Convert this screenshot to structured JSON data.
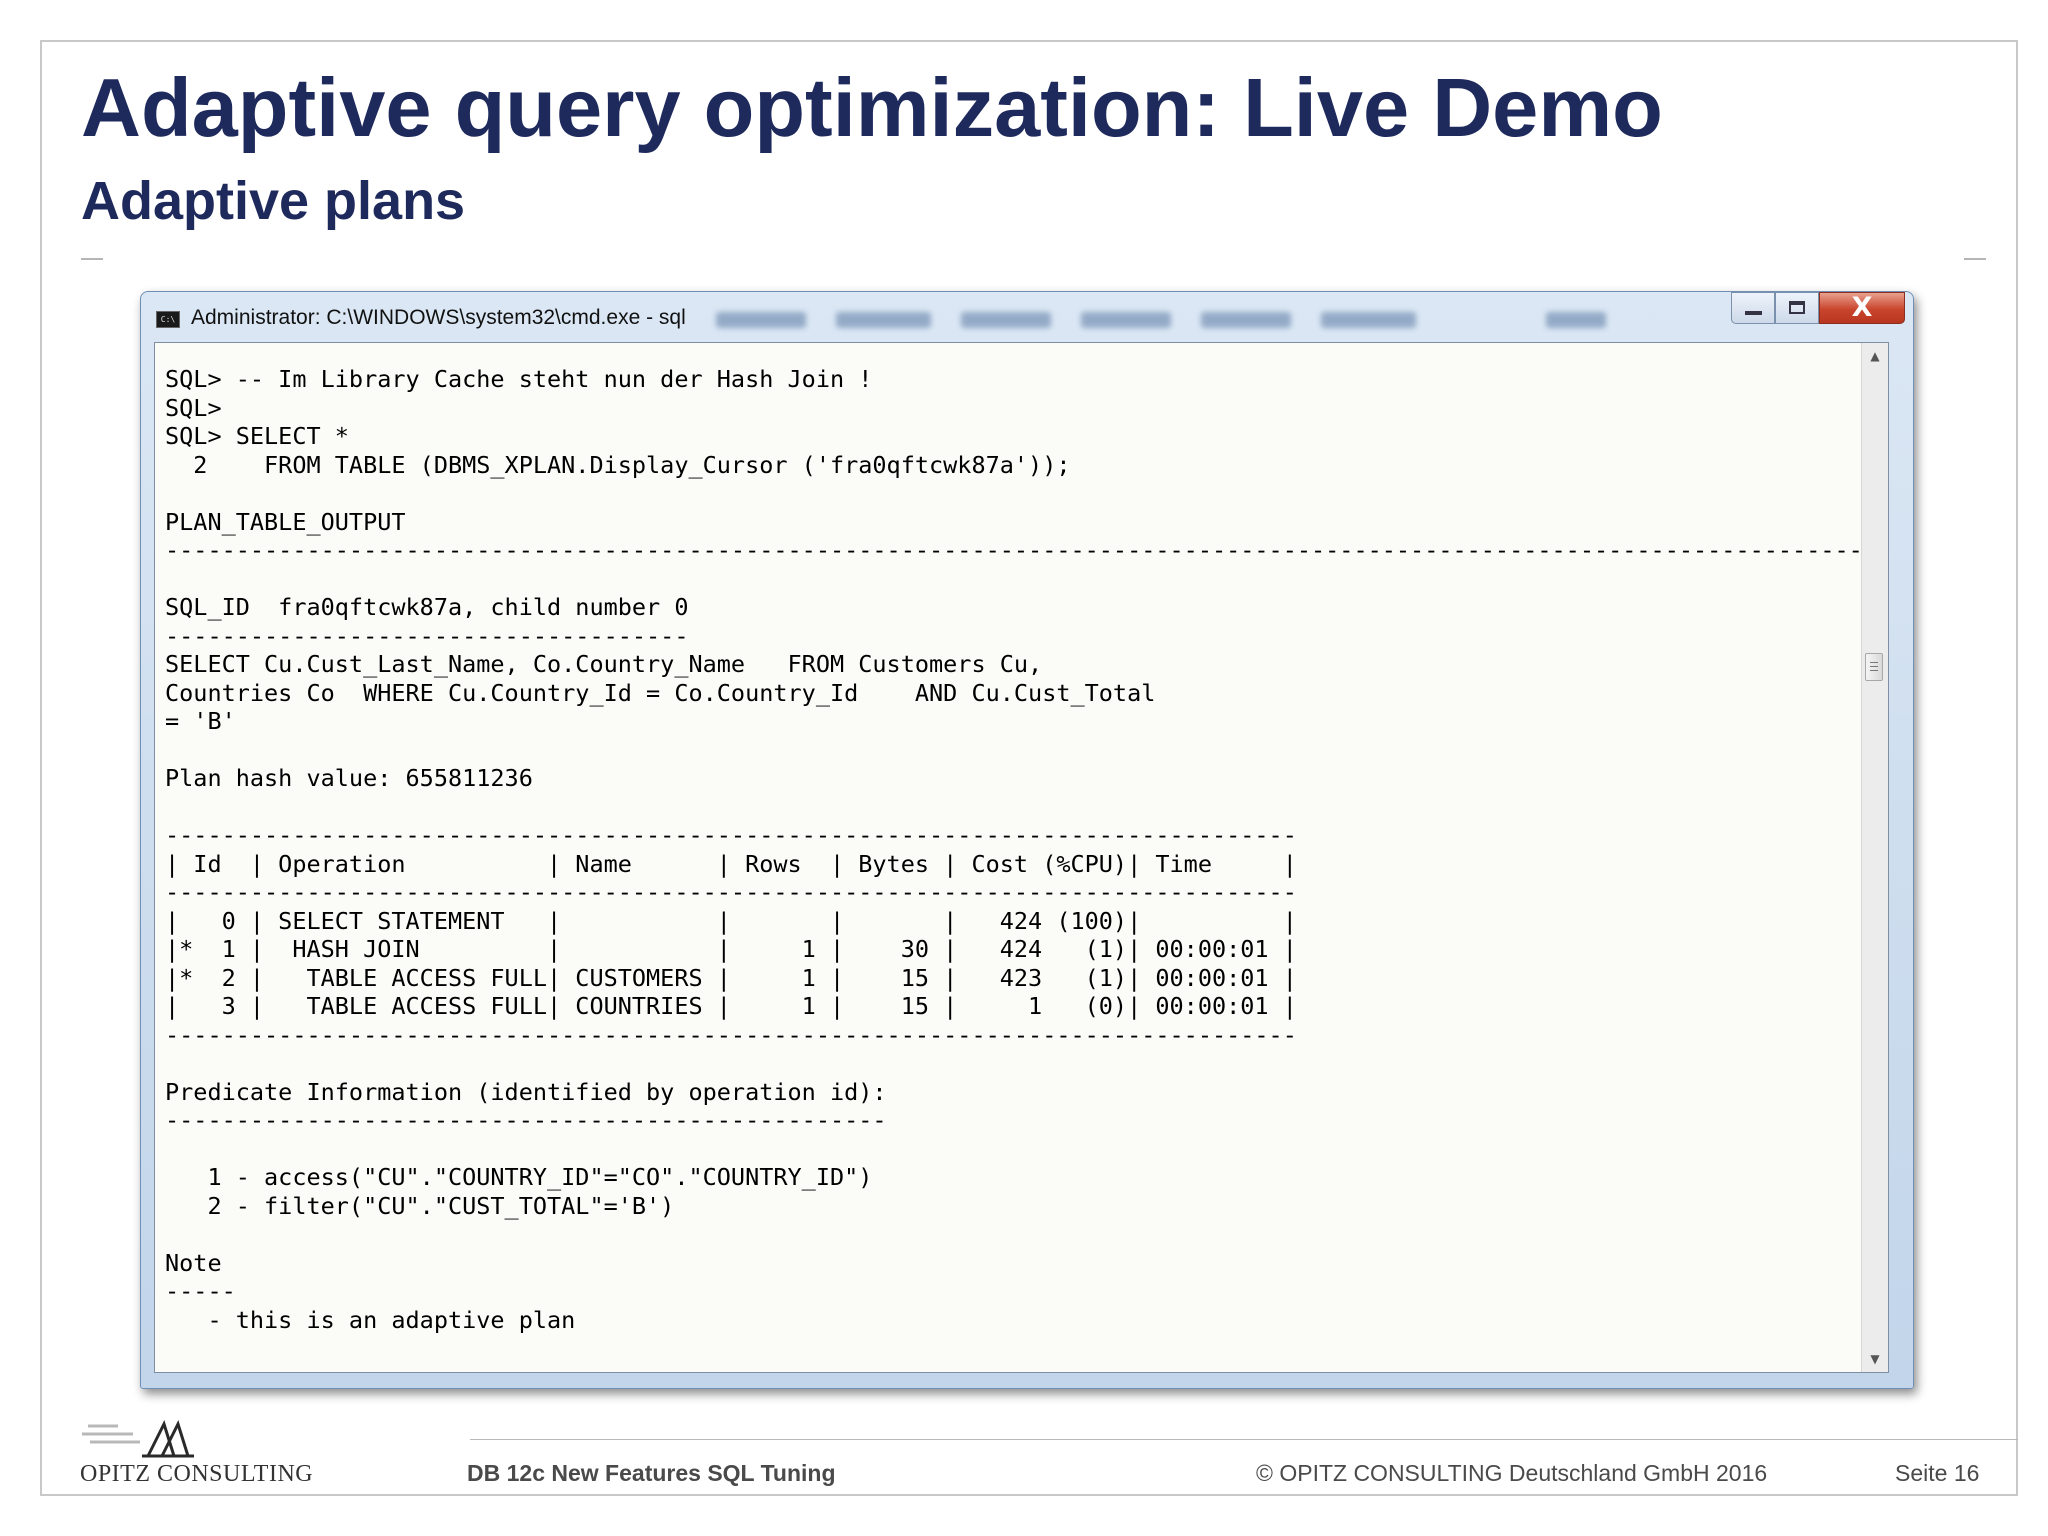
{
  "slide": {
    "title": "Adaptive query optimization: Live Demo",
    "subtitle": "Adaptive plans"
  },
  "window": {
    "title": "Administrator: C:\\WINDOWS\\system32\\cmd.exe - sql",
    "close_glyph": "X",
    "terminal_lines": [
      "SQL> -- Im Library Cache steht nun der Hash Join !",
      "SQL>",
      "SQL> SELECT *",
      "  2    FROM TABLE (DBMS_XPLAN.Display_Cursor ('fra0qftcwk87a'));",
      "",
      "PLAN_TABLE_OUTPUT",
      "------------------------------------------------------------------------------------------------------------------------",
      "",
      "SQL_ID  fra0qftcwk87a, child number 0",
      "-------------------------------------",
      "SELECT Cu.Cust_Last_Name, Co.Country_Name   FROM Customers Cu,",
      "Countries Co  WHERE Cu.Country_Id = Co.Country_Id    AND Cu.Cust_Total",
      "= 'B'",
      "",
      "Plan hash value: 655811236",
      "",
      "--------------------------------------------------------------------------------",
      "| Id  | Operation          | Name      | Rows  | Bytes | Cost (%CPU)| Time     |",
      "--------------------------------------------------------------------------------",
      "|   0 | SELECT STATEMENT   |           |       |       |   424 (100)|          |",
      "|*  1 |  HASH JOIN         |           |     1 |    30 |   424   (1)| 00:00:01 |",
      "|*  2 |   TABLE ACCESS FULL| CUSTOMERS |     1 |    15 |   423   (1)| 00:00:01 |",
      "|   3 |   TABLE ACCESS FULL| COUNTRIES |     1 |    15 |     1   (0)| 00:00:01 |",
      "--------------------------------------------------------------------------------",
      "",
      "Predicate Information (identified by operation id):",
      "---------------------------------------------------",
      "",
      "   1 - access(\"CU\".\"COUNTRY_ID\"=\"CO\".\"COUNTRY_ID\")",
      "   2 - filter(\"CU\".\"CUST_TOTAL\"='B')",
      "",
      "Note",
      "-----",
      "   - this is an adaptive plan"
    ]
  },
  "footer": {
    "logo_text": "OPITZ CONSULTING",
    "center_text": "DB 12c New Features SQL Tuning",
    "copyright": "© OPITZ CONSULTING Deutschland GmbH 2016",
    "page": "Seite 16"
  },
  "colors": {
    "title": "#1f2a5c",
    "close_button": "#c9442c",
    "window_border": "#6f8fb5"
  },
  "icons": {
    "window": "cmd-icon",
    "minimize": "minimize-icon",
    "maximize": "maximize-icon",
    "close": "close-icon",
    "scroll_up": "scroll-up-arrow-icon",
    "scroll_down": "scroll-down-arrow-icon"
  }
}
